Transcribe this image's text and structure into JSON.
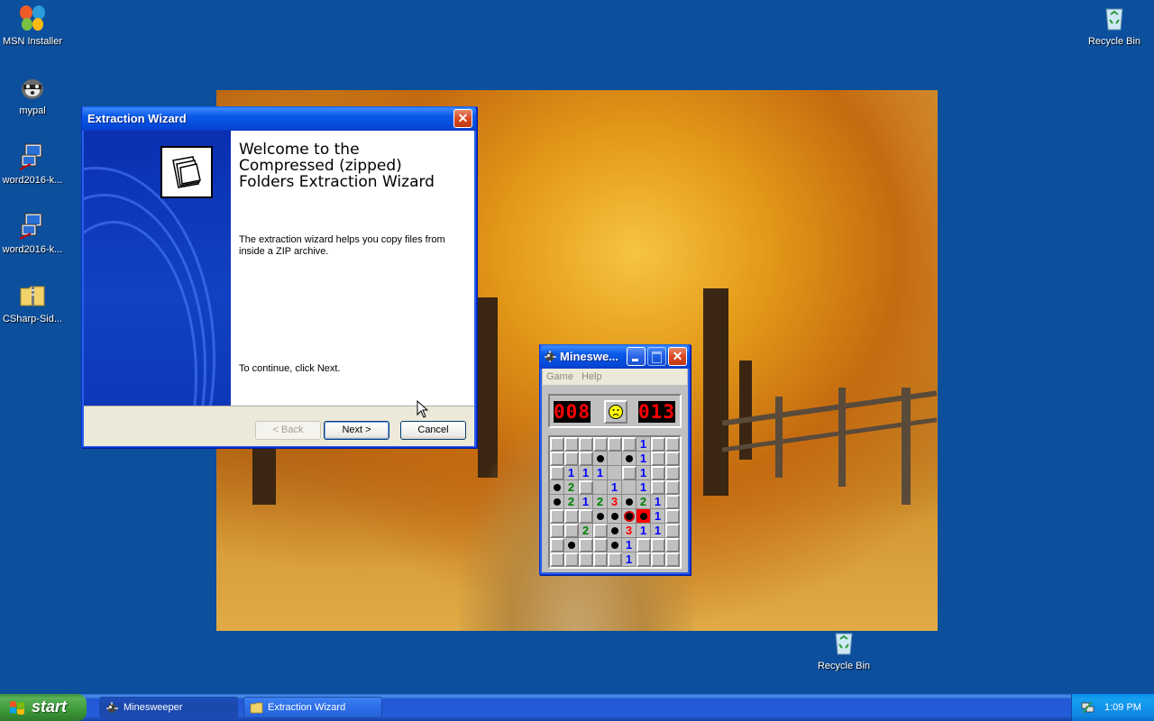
{
  "desktop": {
    "icons": [
      {
        "label": "MSN Installer",
        "icon": "msn-butterfly-icon"
      },
      {
        "label": "mypal",
        "icon": "raccoon-icon"
      },
      {
        "label": "word2016-k...",
        "icon": "network-computer-icon"
      },
      {
        "label": "word2016-k...",
        "icon": "network-computer-icon"
      },
      {
        "label": "CSharp-Sid...",
        "icon": "zip-folder-icon"
      },
      {
        "label": "Recycle Bin",
        "icon": "recycle-bin-icon"
      },
      {
        "label": "Recycle Bin",
        "icon": "recycle-bin-icon"
      }
    ]
  },
  "wizard": {
    "title": "Extraction Wizard",
    "heading": "Welcome to the Compressed (zipped) Folders Extraction Wizard",
    "description": "The extraction wizard helps you copy files from inside a ZIP archive.",
    "continue_text": "To continue, click Next.",
    "back_label": "< Back",
    "next_label": "Next >",
    "cancel_label": "Cancel"
  },
  "minesweeper": {
    "title": "Mineswe...",
    "menu": [
      "Game",
      "Help"
    ],
    "mines_left": "008",
    "timer": "013",
    "face": "sad",
    "rows": [
      "hhhhhh1hh",
      "hhhm.m1hh",
      "h111.h1hh",
      "m2h.1.1hh",
      "m2123m21h",
      "hhhmmxB1h",
      "hh2hm311h",
      "hmhhm1hhh",
      "hhhhh1hhh"
    ]
  },
  "taskbar": {
    "start_label": "start",
    "tasks": [
      {
        "label": "Minesweeper",
        "icon": "minesweeper-icon",
        "active": true
      },
      {
        "label": "Extraction Wizard",
        "icon": "folder-icon",
        "active": false
      }
    ],
    "clock": "1:09 PM"
  }
}
